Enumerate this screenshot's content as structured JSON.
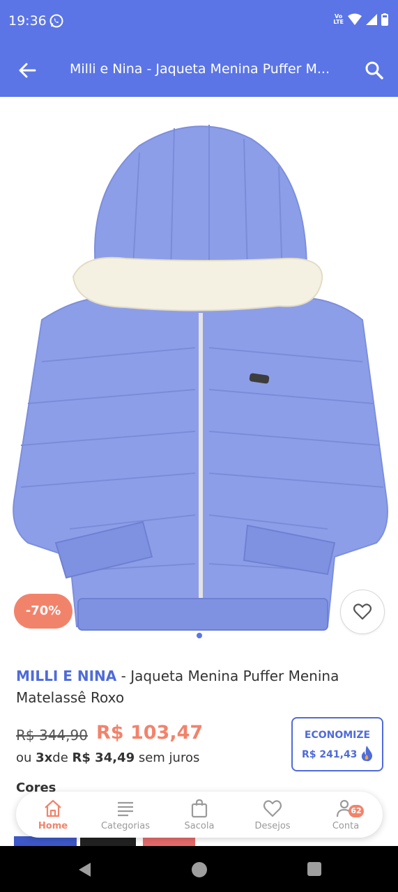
{
  "status_bar": {
    "time": "19:36",
    "volte": "Vo\nLTE"
  },
  "app_bar": {
    "title": "Milli e Nina - Jaqueta Menina Puffer M..."
  },
  "product": {
    "brand": "MILLI E NINA",
    "name_suffix": " - Jaqueta Menina Puffer Menina Matelassê Roxo",
    "discount_badge": "-70%",
    "old_price": "R$ 344,90",
    "new_price": "R$ 103,47",
    "installments": {
      "prefix": "ou ",
      "count": "3x",
      "middle": "de ",
      "amount": "R$ 34,49",
      "suffix": " sem juros"
    },
    "savings": {
      "label": "ECONOMIZE",
      "amount": "R$ 241,43"
    },
    "colors_label": "Cores",
    "color_swatches": [
      "#3d58c8",
      "#222222",
      "#e66a6a"
    ],
    "jacket_color": "#8d9ee9"
  },
  "bottom_nav": {
    "items": [
      {
        "label": "Home",
        "icon": "home-icon",
        "active": true
      },
      {
        "label": "Categorias",
        "icon": "list-icon",
        "active": false
      },
      {
        "label": "Sacola",
        "icon": "bag-icon",
        "active": false
      },
      {
        "label": "Desejos",
        "icon": "heart-icon",
        "active": false
      },
      {
        "label": "Conta",
        "icon": "user-icon",
        "active": false,
        "badge": "62"
      }
    ]
  },
  "colors": {
    "primary": "#5b75e6",
    "accent": "#f2836b",
    "brand_text": "#4f6bd9"
  }
}
